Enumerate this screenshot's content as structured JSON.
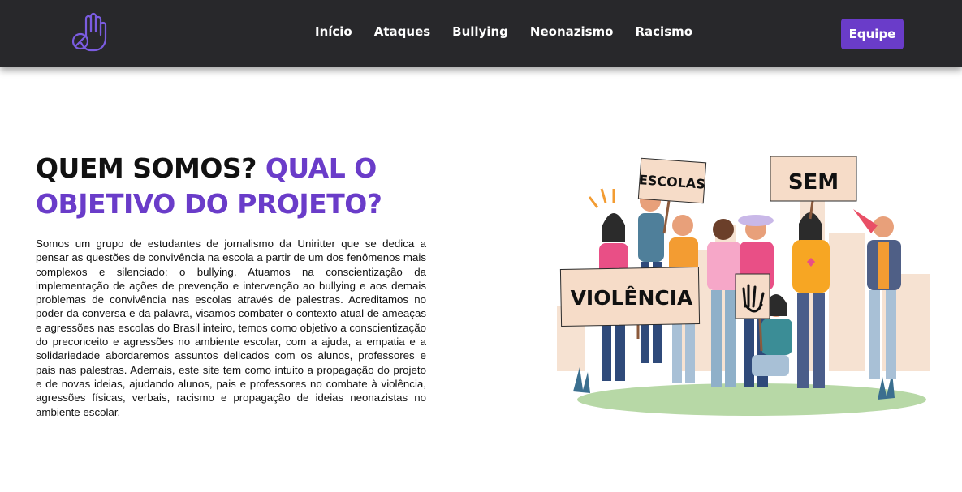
{
  "nav": {
    "logo_icon": "hand-stop-icon",
    "links": [
      "Início",
      "Ataques",
      "Bullying",
      "Neonazismo",
      "Racismo"
    ],
    "team_button": "Equipe"
  },
  "hero": {
    "title_part1": "QUEM SOMOS?",
    "title_part2": "QUAL O OBJETIVO DO PROJETO?",
    "paragraph": "Somos um grupo de estudantes de jornalismo da Uniritter que se dedica a pensar as questões de convivência na escola a partir de um dos fenômenos mais complexos e silenciado: o bullying. Atuamos na conscientização da implementação de ações de prevenção e intervenção ao bullying e aos demais problemas de convivência nas escolas através de palestras. Acreditamos no poder da conversa e da palavra, visamos combater o contexto atual de ameaças e agressões nas escolas do Brasil inteiro, temos como objetivo a conscientização do preconceito e agressões no ambiente escolar, com a ajuda, a empatia e a solidariedade abordaremos assuntos delicados com os alunos, professores e pais nas palestras. Ademais, este site tem como intuito a propagação do projeto e de novas ideias, ajudando alunos, pais e professores no combate à violência, agressões físicas, verbais, racismo e propagação de ideias neonazistas no ambiente escolar."
  },
  "illustration": {
    "sign_escolas": "ESCOLAS",
    "sign_sem": "SEM",
    "sign_violencia": "VIOLÊNCIA"
  },
  "colors": {
    "navbar": "#28282b",
    "accent": "#6a3cc9",
    "text": "#111111"
  }
}
